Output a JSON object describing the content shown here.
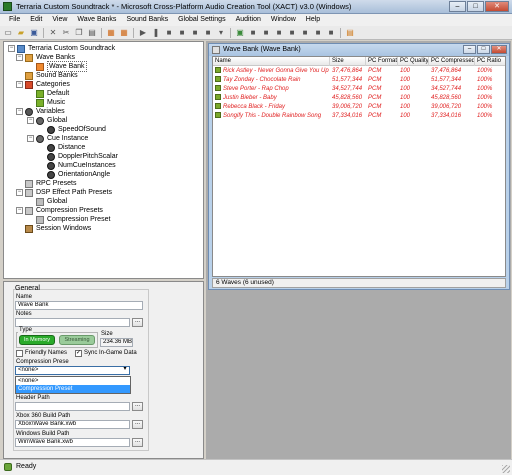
{
  "window": {
    "title": "Terraria Custom Soundtrack * - Microsoft Cross-Platform Audio Creation Tool (XACT) v3.0 (Windows)",
    "minimize": "–",
    "maximize": "□",
    "close": "✕"
  },
  "menu": [
    "File",
    "Edit",
    "View",
    "Wave Banks",
    "Sound Banks",
    "Global Settings",
    "Audition",
    "Window",
    "Help"
  ],
  "toolbar_icons": [
    "new-icon",
    "open-icon",
    "save-icon",
    "delete-icon",
    "cut-icon",
    "copy-icon",
    "paste-icon",
    "wave-bank-icon",
    "sound-bank-icon",
    "play-icon",
    "pause-icon",
    "stop-icon",
    "loop-icon",
    "build-icon"
  ],
  "tree": {
    "root": "Terraria Custom Soundtrack",
    "wave_banks": "Wave Banks",
    "wave_bank": "Wave Bank",
    "sound_banks": "Sound Banks",
    "categories": "Categories",
    "default": "Default",
    "music": "Music",
    "variables": "Variables",
    "global": "Global",
    "speed_of_sound": "SpeedOfSound",
    "cue_instance": "Cue Instance",
    "distance": "Distance",
    "doppler": "DopplerPitchScalar",
    "num_cue_instances": "NumCueInstances",
    "orientation": "OrientationAngle",
    "rpc_presets": "RPC Presets",
    "dsp_presets": "DSP Effect Path Presets",
    "dsp_global": "Global",
    "compression_presets": "Compression Presets",
    "compression_preset": "Compression Preset",
    "session_windows": "Session Windows",
    "colors": {
      "selected_border": "#666666"
    }
  },
  "properties": {
    "section": "General",
    "name_label": "Name",
    "name_value": "Wave Bank",
    "notes_label": "Notes",
    "notes_value": "",
    "type_label": "Type",
    "type_in_memory": "In Memory",
    "type_streaming": "Streaming",
    "size_label": "Size",
    "size_value": "234.36 MB",
    "friendly_names_label": "Friendly Names",
    "friendly_names_checked": false,
    "sync_label": "Sync In-Game Data",
    "sync_checked": true,
    "compression_label": "Compression Prese",
    "compression_value": "<none>",
    "dropdown_options": [
      "<none>",
      "Compression Preset"
    ],
    "dropdown_highlight_index": 1,
    "header_path_label": "Header Path",
    "header_path_value": "",
    "xbox_path_label": "Xbox 360 Build Path",
    "xbox_path_value": "Xbox\\Wave Bank.xwb",
    "windows_path_label": "Windows Build Path",
    "windows_path_value": "Win\\Wave Bank.xwb",
    "browse_label": "...",
    "checkmark": "✓",
    "dropdown_arrow": "▾"
  },
  "wave_window": {
    "title": "Wave Bank (Wave Bank)",
    "columns": [
      "Name",
      "Size",
      "PC Format",
      "PC Quality",
      "PC Compressed",
      "PC Ratio"
    ],
    "rows": [
      {
        "name": "Rick Astley - Never Gonna Give You Up",
        "size": "37,476,864",
        "format": "PCM",
        "quality": "100",
        "compressed": "37,476,864",
        "ratio": "100%"
      },
      {
        "name": "Tay Zonday - Chocolate Rain",
        "size": "51,577,344",
        "format": "PCM",
        "quality": "100",
        "compressed": "51,577,344",
        "ratio": "100%"
      },
      {
        "name": "Steve Porter - Rap Chop",
        "size": "34,527,744",
        "format": "PCM",
        "quality": "100",
        "compressed": "34,527,744",
        "ratio": "100%"
      },
      {
        "name": "Justin Bieber - Baby",
        "size": "45,828,560",
        "format": "PCM",
        "quality": "100",
        "compressed": "45,828,560",
        "ratio": "100%"
      },
      {
        "name": "Rebecca Black - Friday",
        "size": "39,006,720",
        "format": "PCM",
        "quality": "100",
        "compressed": "39,006,720",
        "ratio": "100%"
      },
      {
        "name": "Songify This - Double Rainbow Song",
        "size": "37,334,016",
        "format": "PCM",
        "quality": "100",
        "compressed": "37,334,016",
        "ratio": "100%"
      }
    ],
    "status": "6 Waves (6 unused)",
    "colors": {
      "row_text": "#e02020",
      "wave_icon": "#7aa82a"
    }
  },
  "statusbar": {
    "text": "Ready"
  },
  "colors": {
    "title_gradient_top": "#cfdbeb",
    "mdi_background": "#ababab",
    "selection": "#3399ff"
  }
}
